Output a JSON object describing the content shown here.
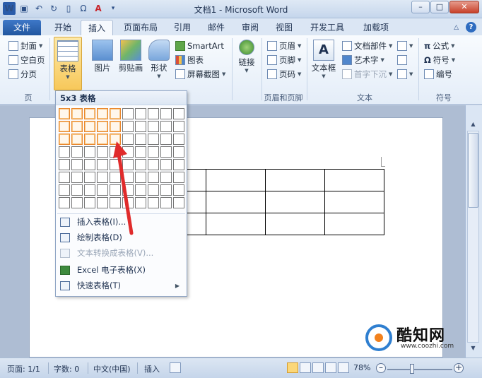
{
  "window": {
    "title": "文档1 - Microsoft Word",
    "app_icon": "W"
  },
  "quick_access": {
    "icons": [
      "word-icon",
      "save-icon",
      "undo-icon",
      "redo-icon",
      "new-doc-icon",
      "omega-icon",
      "font-color-icon",
      "customize-icon"
    ]
  },
  "tabs": [
    {
      "label": "文件",
      "file": true
    },
    {
      "label": "开始"
    },
    {
      "label": "插入",
      "active": true
    },
    {
      "label": "页面布局"
    },
    {
      "label": "引用"
    },
    {
      "label": "邮件"
    },
    {
      "label": "审阅"
    },
    {
      "label": "视图"
    },
    {
      "label": "开发工具"
    },
    {
      "label": "加载项"
    }
  ],
  "ribbon": {
    "pages_group": {
      "label": "页",
      "cover": "封面",
      "blank": "空白页",
      "break": "分页"
    },
    "table_group": {
      "table": "表格"
    },
    "illustrations": {
      "picture": "图片",
      "clipart": "剪贴画",
      "shapes": "形状",
      "smartart": "SmartArt",
      "chart": "图表",
      "screenshot": "屏幕截图"
    },
    "links_group": {
      "link": "链接"
    },
    "header_footer": {
      "label": "页眉和页脚",
      "header": "页眉",
      "footer": "页脚",
      "page_num": "页码"
    },
    "text_group": {
      "label": "文本",
      "textbox": "文本框",
      "quickparts": "文档部件",
      "wordart": "艺术字",
      "dropcap": "首字下沉"
    },
    "symbols_group": {
      "label": "符号",
      "equation": "公式",
      "symbol": "符号",
      "number": "编号"
    }
  },
  "dropdown": {
    "header": "5x3 表格",
    "grid_cols": 10,
    "grid_rows": 8,
    "highlight_cols": 5,
    "highlight_rows": 3,
    "items": [
      {
        "label": "插入表格(I)...",
        "enabled": true
      },
      {
        "label": "绘制表格(D)",
        "enabled": true
      },
      {
        "label": "文本转换成表格(V)...",
        "enabled": false
      },
      {
        "label": "Excel 电子表格(X)",
        "enabled": true
      },
      {
        "label": "快速表格(T)",
        "enabled": true,
        "submenu": true
      }
    ]
  },
  "document": {
    "table_rows": 3,
    "table_cols": 4
  },
  "statusbar": {
    "page": "页面: 1/1",
    "words": "字数: 0",
    "language": "中文(中国)",
    "mode": "插入",
    "zoom": "78%",
    "zoom_level": 0.78
  },
  "watermark": {
    "name": "酷知网",
    "url": "www.coozhi.com"
  },
  "colors": {
    "file_tab": "#2a5caa",
    "highlight": "#e9872d",
    "arrow": "#e02b2b"
  }
}
